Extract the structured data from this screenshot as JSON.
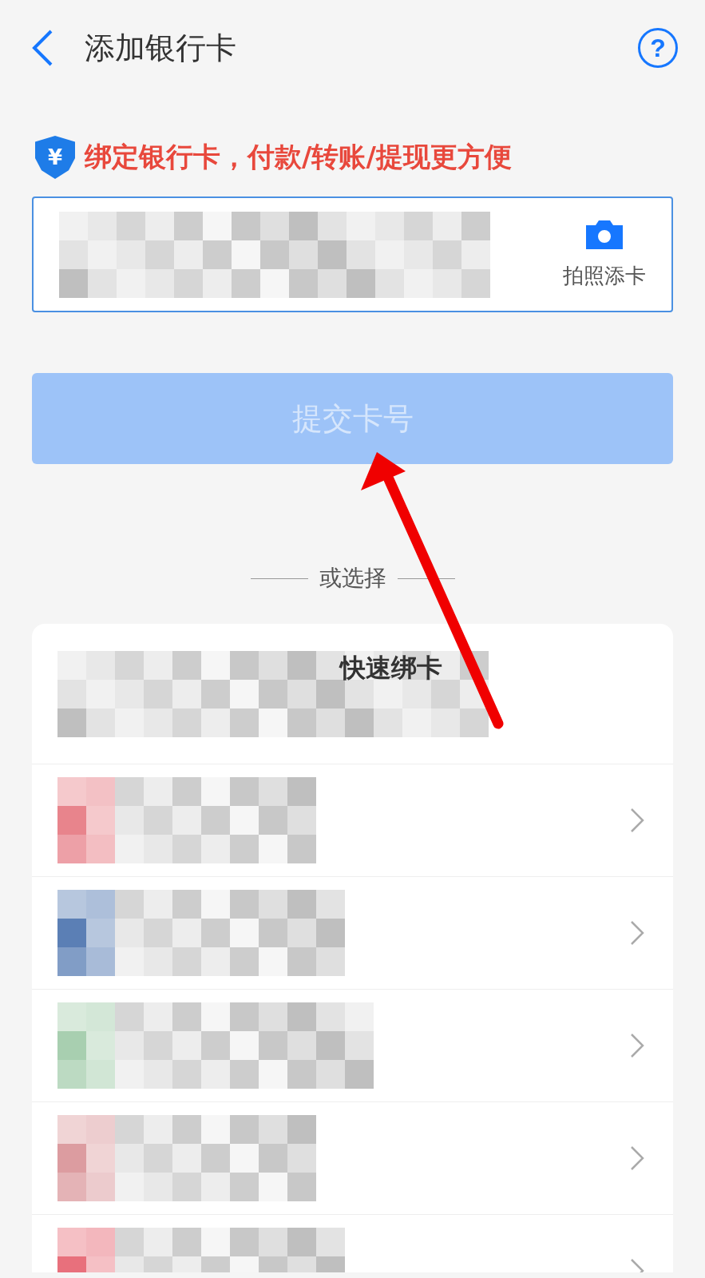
{
  "header": {
    "title": "添加银行卡",
    "help_symbol": "?"
  },
  "notice": {
    "badge_symbol": "¥",
    "text": "绑定银行卡，付款/转账/提现更方便"
  },
  "card_input": {
    "kind": "pixelated",
    "scan_label": "拍照添卡"
  },
  "submit_button": {
    "label": "提交卡号",
    "disabled": true
  },
  "divider_label": "或选择",
  "quick_bind": {
    "label": "快速绑卡"
  },
  "banks": [
    {
      "color": "#e8848c"
    },
    {
      "color": "#5b7fb5"
    },
    {
      "color": "#a8cfb0"
    },
    {
      "color": "#dc9ca0"
    },
    {
      "color": "#e8707c"
    }
  ],
  "annotation": {
    "color": "#f00000"
  }
}
